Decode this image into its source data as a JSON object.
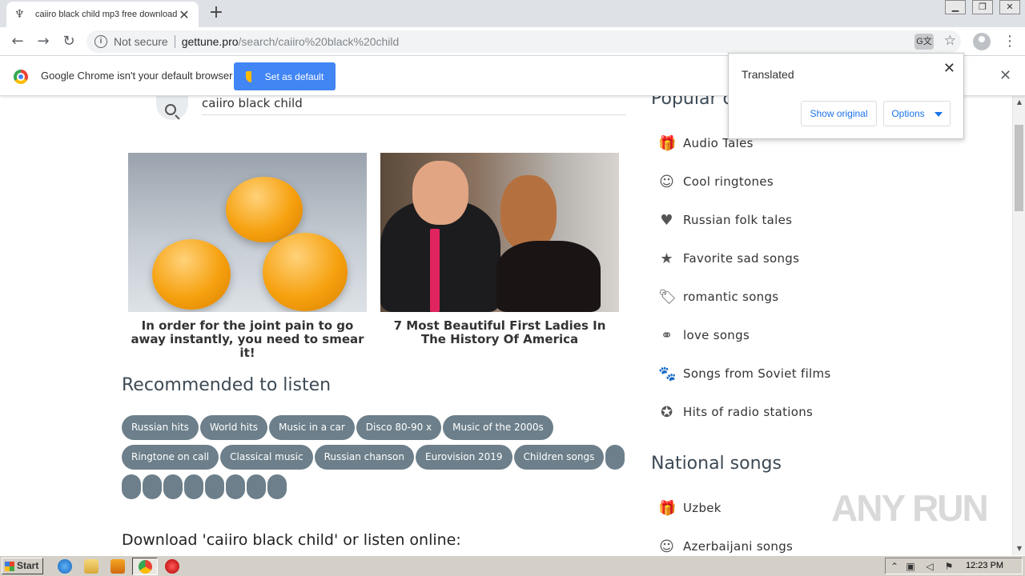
{
  "browser": {
    "tab_title": "caiiro black child mp3 free download",
    "tab_close": "✕",
    "new_tab": "+",
    "url_security": "Not secure",
    "url_host": "gettune.pro",
    "url_path": "/search/caiiro%20black%20child"
  },
  "infobar": {
    "message": "Google Chrome isn't your default browser",
    "button": "Set as default",
    "close": "✕"
  },
  "translate_popup": {
    "title": "Translated",
    "show_original": "Show original",
    "options": "Options",
    "close": "✕"
  },
  "search": {
    "query": "caiiro black child"
  },
  "ads": [
    {
      "title": "In order for the joint pain to go away instantly, you need to smear it!"
    },
    {
      "title": "7 Most Beautiful First Ladies In The History Of America"
    }
  ],
  "recommended": {
    "title": "Recommended to listen",
    "tags": [
      "Russian hits",
      "World hits",
      "Music in a car",
      "Disco 80-90 x",
      "Music of the 2000s",
      "Ringtone on call",
      "Classical music",
      "Russian chanson",
      "Eurovision 2019",
      "Children songs"
    ],
    "blank_tags": 9
  },
  "download_title": "Download 'caiiro black child' or listen online:",
  "sidebar": {
    "popular_title": "Popular c",
    "popular_items": [
      {
        "icon": "gift-icon",
        "label": "Audio Tales"
      },
      {
        "icon": "smile-icon",
        "label": "Cool ringtones"
      },
      {
        "icon": "heart-icon",
        "label": "Russian folk tales"
      },
      {
        "icon": "star-icon",
        "label": "Favorite sad songs"
      },
      {
        "icon": "tag-icon",
        "label": "romantic songs"
      },
      {
        "icon": "bicycle-icon",
        "label": "love songs"
      },
      {
        "icon": "paw-icon",
        "label": "Songs from Soviet films"
      },
      {
        "icon": "star-circle-icon",
        "label": "Hits of radio stations"
      }
    ],
    "national_title": "National songs",
    "national_items": [
      {
        "icon": "gift-icon",
        "label": "Uzbek"
      },
      {
        "icon": "smile-icon",
        "label": "Azerbaijani songs"
      }
    ]
  },
  "watermark": "ANY RUN",
  "taskbar": {
    "start": "Start",
    "clock": "12:23 PM"
  }
}
